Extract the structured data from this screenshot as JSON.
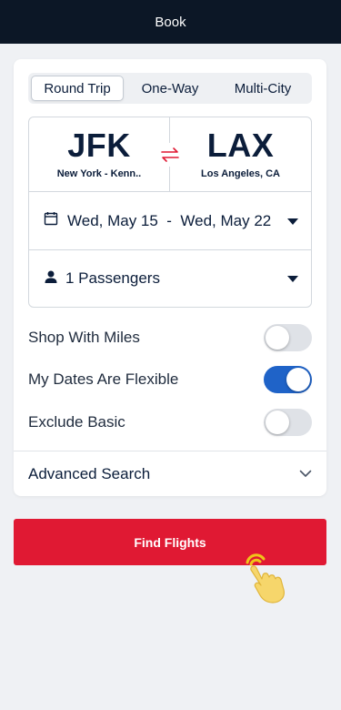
{
  "header": {
    "title": "Book"
  },
  "trip_types": [
    {
      "label": "Round Trip",
      "active": true
    },
    {
      "label": "One-Way",
      "active": false
    },
    {
      "label": "Multi-City",
      "active": false
    }
  ],
  "route": {
    "origin": {
      "code": "JFK",
      "city": "New York - Kenn.."
    },
    "destination": {
      "code": "LAX",
      "city": "Los Angeles, CA"
    },
    "swap_icon": "swap-arrows-icon"
  },
  "dates": {
    "text": "Wed, May 15  -  Wed, May 22",
    "icon": "calendar-icon"
  },
  "passengers": {
    "text": "1 Passengers",
    "icon": "person-icon"
  },
  "options": [
    {
      "label": "Shop With Miles",
      "on": false
    },
    {
      "label": "My Dates Are Flexible",
      "on": true
    },
    {
      "label": "Exclude Basic",
      "on": false
    }
  ],
  "advanced": {
    "label": "Advanced Search",
    "icon": "chevron-down-icon"
  },
  "find_button": {
    "label": "Find Flights"
  },
  "colors": {
    "header_bg": "#0c1726",
    "accent_red": "#e01933",
    "toggle_on": "#1f63c8",
    "text_navy": "#0b1d3a"
  }
}
